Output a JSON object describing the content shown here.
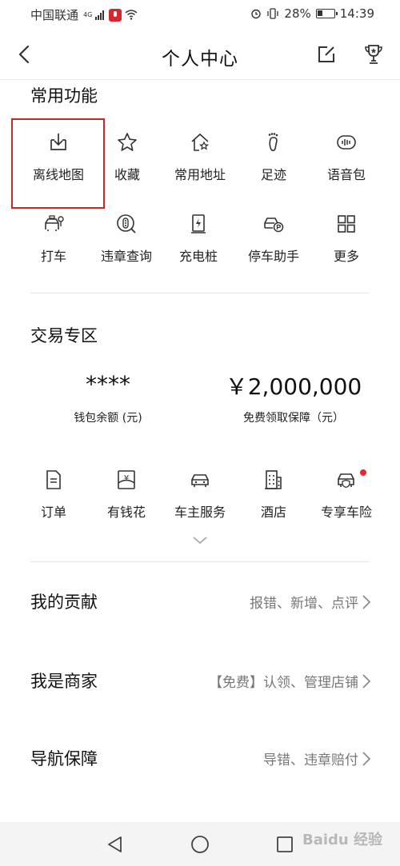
{
  "status_bar": {
    "carrier": "中国联通",
    "network": "4G",
    "battery": "28%",
    "time": "14:39"
  },
  "header": {
    "title": "个人中心"
  },
  "common": {
    "title": "常用功能",
    "items": [
      {
        "label": "离线地图",
        "icon": "offline-map-icon"
      },
      {
        "label": "收藏",
        "icon": "star-icon"
      },
      {
        "label": "常用地址",
        "icon": "home-star-icon"
      },
      {
        "label": "足迹",
        "icon": "footprint-icon"
      },
      {
        "label": "语音包",
        "icon": "voice-pack-icon"
      },
      {
        "label": "打车",
        "icon": "taxi-icon"
      },
      {
        "label": "违章查询",
        "icon": "violation-query-icon"
      },
      {
        "label": "充电桩",
        "icon": "charging-pile-icon"
      },
      {
        "label": "停车助手",
        "icon": "parking-assistant-icon"
      },
      {
        "label": "更多",
        "icon": "more-grid-icon"
      }
    ]
  },
  "trade": {
    "title": "交易专区",
    "wallet_value": "****",
    "wallet_label": "钱包余额 (元)",
    "guarantee_value": "￥2,000,000",
    "guarantee_label": "免费领取保障（元）",
    "items": [
      {
        "label": "订单",
        "icon": "order-icon"
      },
      {
        "label": "有钱花",
        "icon": "loan-icon"
      },
      {
        "label": "车主服务",
        "icon": "car-service-icon"
      },
      {
        "label": "酒店",
        "icon": "hotel-icon"
      },
      {
        "label": "专享车险",
        "icon": "car-insurance-icon"
      }
    ]
  },
  "rows": [
    {
      "title": "我的贡献",
      "detail": "报错、新增、点评"
    },
    {
      "title": "我是商家",
      "detail": "【免费】认领、管理店铺"
    },
    {
      "title": "导航保障",
      "detail": "导错、违章赔付"
    }
  ],
  "watermark": "Baidu 经验",
  "colors": {
    "highlight": "#c8282a",
    "notification_dot": "#e8262f",
    "text_primary": "#111111",
    "text_secondary": "#777777"
  }
}
